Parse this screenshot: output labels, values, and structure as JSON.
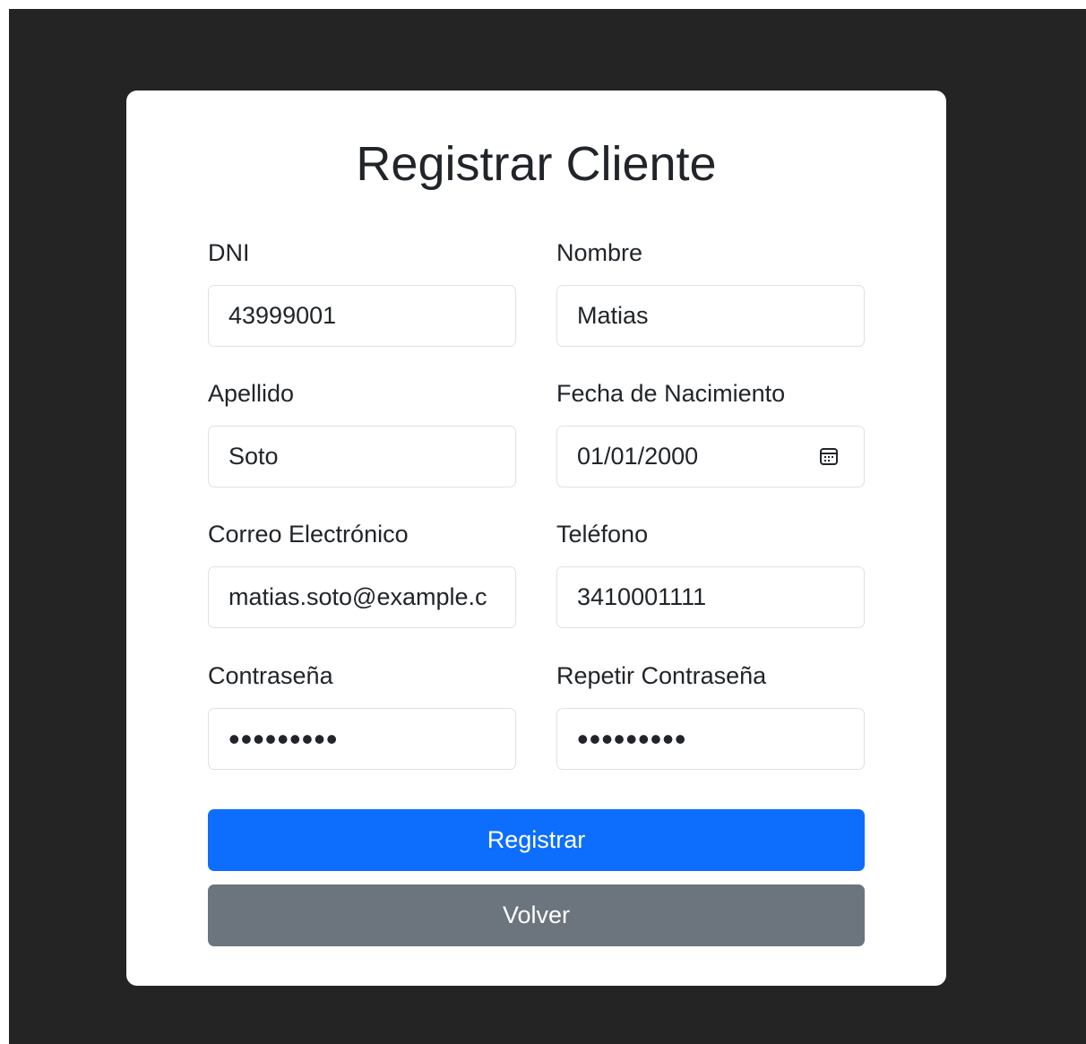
{
  "form": {
    "title": "Registrar Cliente",
    "fields": {
      "dni": {
        "label": "DNI",
        "value": "43999001"
      },
      "nombre": {
        "label": "Nombre",
        "value": "Matias"
      },
      "apellido": {
        "label": "Apellido",
        "value": "Soto"
      },
      "fecha_nacimiento": {
        "label": "Fecha de Nacimiento",
        "value": "01/01/2000",
        "icon": "calendar-icon"
      },
      "correo": {
        "label": "Correo Electrónico",
        "value": "matias.soto@example.c"
      },
      "telefono": {
        "label": "Teléfono",
        "value": "3410001111"
      },
      "contrasena": {
        "label": "Contraseña",
        "value": "•••••••••"
      },
      "repetir_contrasena": {
        "label": "Repetir Contraseña",
        "value": "•••••••••"
      }
    },
    "buttons": {
      "register_label": "Registrar",
      "back_label": "Volver"
    }
  },
  "colors": {
    "background": "#242424",
    "card": "#ffffff",
    "primary": "#0d6efd",
    "secondary": "#6c757d",
    "text": "#212529",
    "input_border": "#dee2e6"
  }
}
